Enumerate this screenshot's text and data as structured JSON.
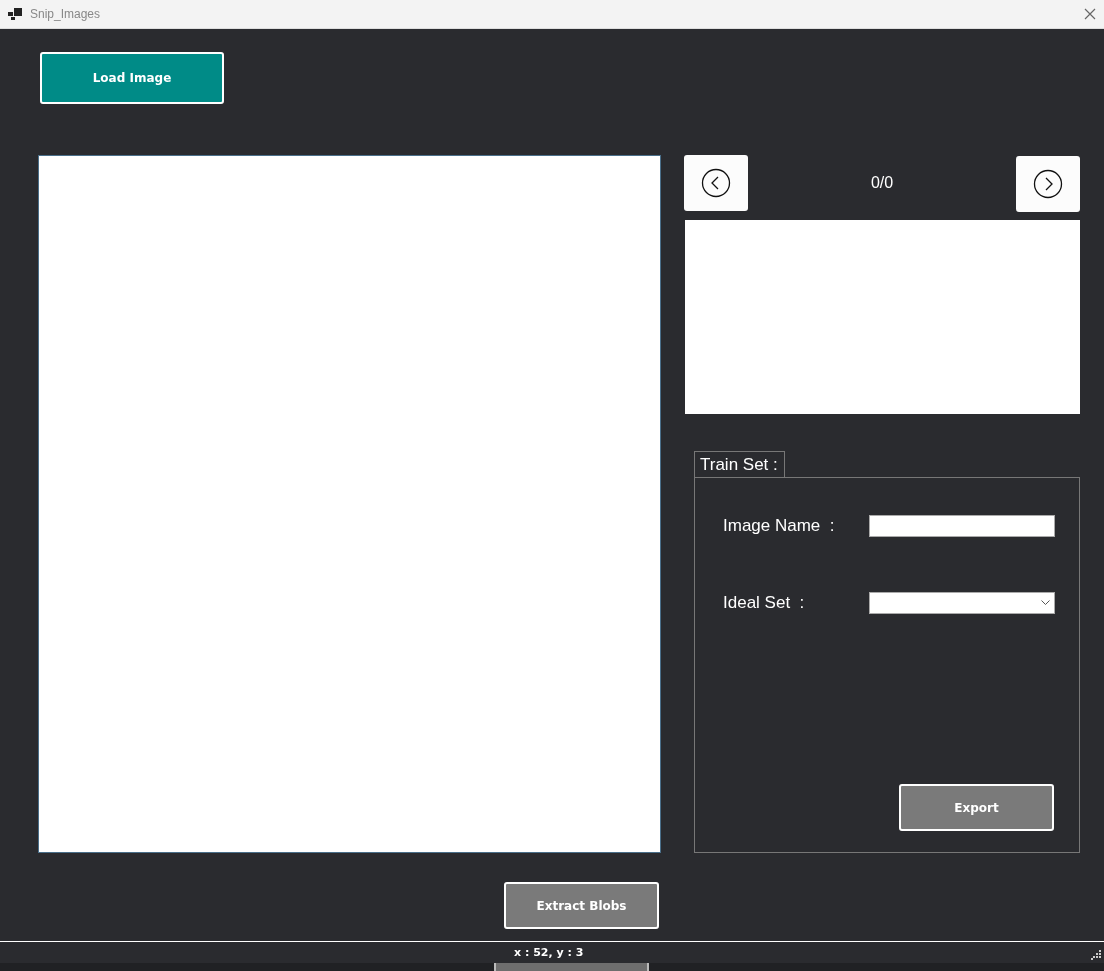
{
  "window": {
    "title": "Snip_Images"
  },
  "load_button": {
    "label": "Load Image"
  },
  "navigator": {
    "counter": "0/0"
  },
  "train_set": {
    "title": "Train Set :",
    "fields": [
      {
        "kind": "text",
        "label": "Image Name  :"
      },
      {
        "kind": "dropdown",
        "label": "Ideal Set  :"
      }
    ],
    "export_button": "Export"
  },
  "extract_button": {
    "label": "Extract Blobs"
  },
  "status_bar": {
    "text": "x : 52, y : 3"
  }
}
